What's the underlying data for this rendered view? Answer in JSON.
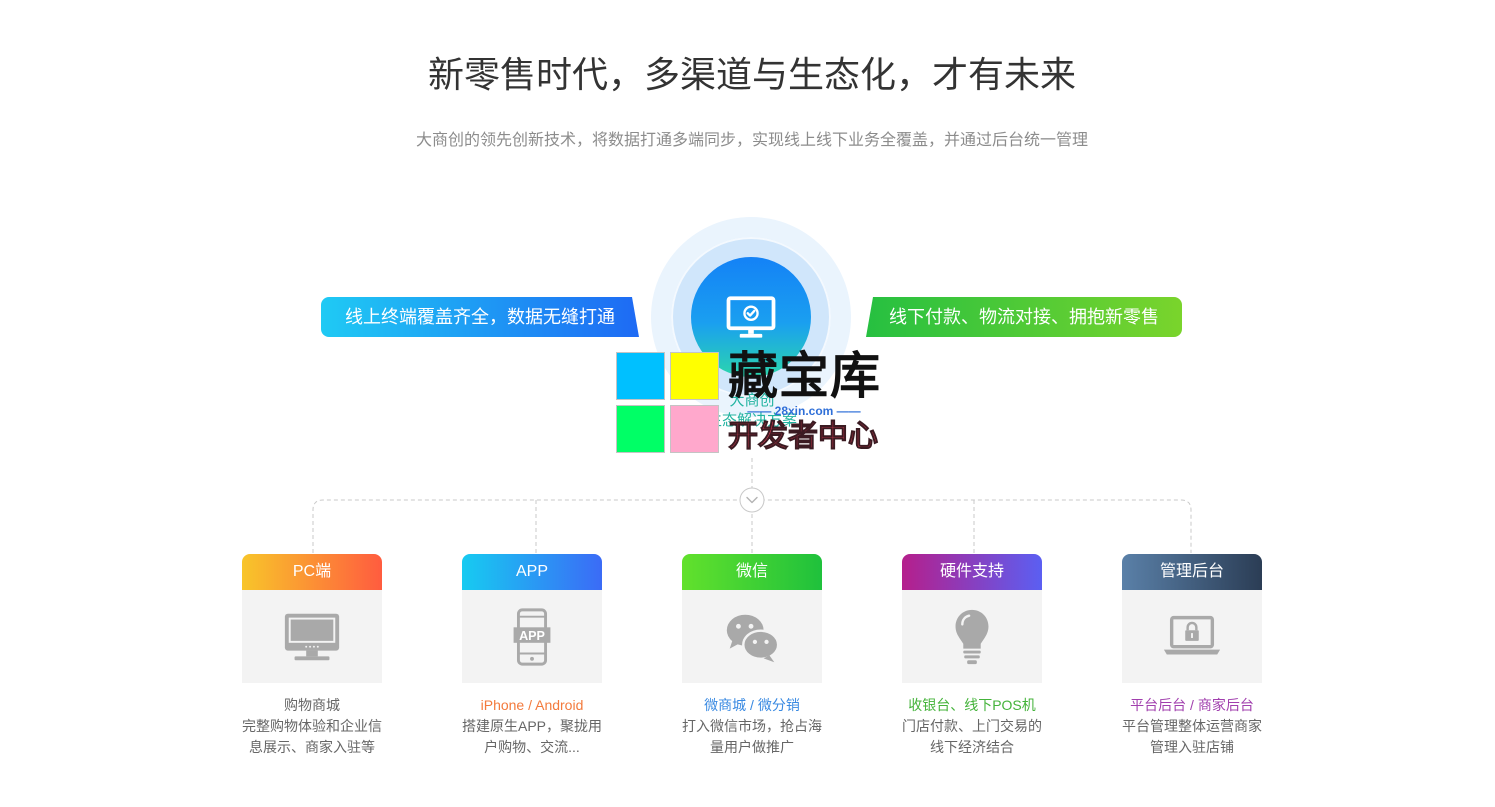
{
  "header": {
    "title": "新零售时代，多渠道与生态化，才有未来",
    "subtitle": "大商创的领先创新技术，将数据打通多端同步，实现线上线下业务全覆盖，并通过后台统一管理"
  },
  "hub": {
    "left_tag": "线上终端覆盖齐全，数据无缝打通",
    "right_tag": "线下付款、物流对接、拥抱新零售",
    "left_tag_gradient": [
      "#1fcaf4",
      "#1e6af4"
    ],
    "right_tag_gradient": [
      "#26c041",
      "#7ad42c"
    ],
    "center_icon": "monitor-check-icon",
    "center_name": "大商创",
    "center_caption": "生态解决方案"
  },
  "watermark": {
    "brand": "藏宝库",
    "site": "—— 28xin.com ——",
    "tagline": "开发者中心",
    "tile_colors": [
      "#00c0ff",
      "#ffff00",
      "#00ff66",
      "#ffa8cc"
    ]
  },
  "connector": {
    "icon": "chevron-down-icon"
  },
  "cards": [
    {
      "label": "PC端",
      "icon": "desktop-monitor-icon",
      "headline": "购物商城",
      "desc": [
        "完整购物体验和企业信",
        "息展示、商家入驻等"
      ],
      "header_gradient": [
        "#f8c52a",
        "#ff5c3f"
      ],
      "headline_color": "#666666"
    },
    {
      "label": "APP",
      "icon": "mobile-app-icon",
      "icon_text": "APP",
      "headline": "iPhone / Android",
      "desc": [
        "搭建原生APP，聚拢用",
        "户购物、交流..."
      ],
      "header_gradient": [
        "#17cbf1",
        "#3b6bf6"
      ],
      "headline_color": "#f37a3c"
    },
    {
      "label": "微信",
      "icon": "wechat-icon",
      "headline": "微商城 / 微分销",
      "desc": [
        "打入微信市场，抢占海",
        "量用户做推广"
      ],
      "header_gradient": [
        "#62e12c",
        "#1fc13c"
      ],
      "headline_color": "#3a8ae2"
    },
    {
      "label": "硬件支持",
      "icon": "lightbulb-icon",
      "headline": "收银台、线下POS机",
      "desc": [
        "门店付款、上门交易的",
        "线下经济结合"
      ],
      "header_gradient": [
        "#b51f8c",
        "#5b5ff2"
      ],
      "headline_color": "#44b33a"
    },
    {
      "label": "管理后台",
      "icon": "laptop-lock-icon",
      "headline": "平台后台 / 商家后台",
      "desc": [
        "平台管理整体运营商家",
        "管理入驻店铺"
      ],
      "header_gradient": [
        "#5a80a8",
        "#2b3d55"
      ],
      "headline_color": "#a13fae"
    }
  ]
}
